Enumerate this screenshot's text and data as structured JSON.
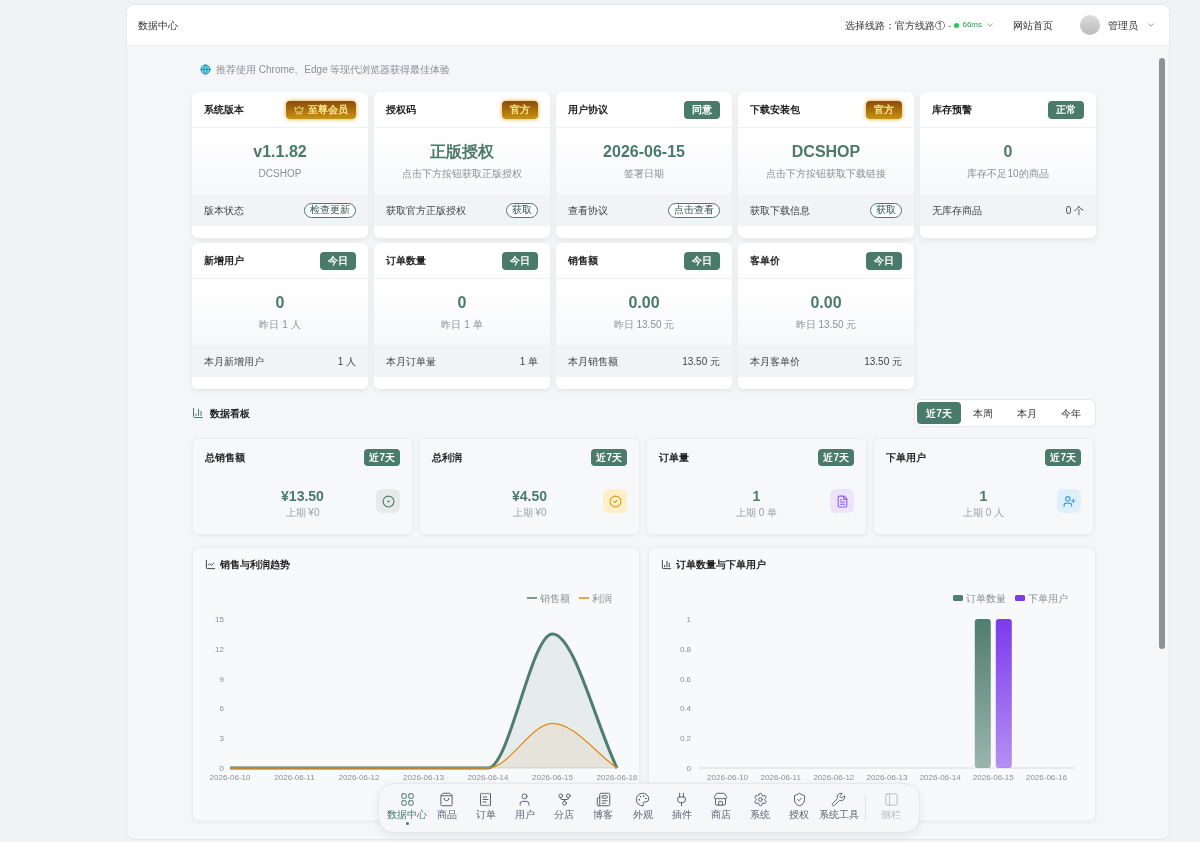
{
  "topbar": {
    "title": "数据中心",
    "route_label": "选择线路：官方线路①",
    "separator": "-",
    "latency": "66ms",
    "home_link": "网站首页",
    "user": "管理员"
  },
  "notice": "推荐使用 Chrome、Edge 等现代浏览器获得最佳体验",
  "info_cards": [
    {
      "title": "系统版本",
      "badge": {
        "text": "至尊会员",
        "kind": "vip"
      },
      "value": "v1.1.82",
      "caption": "DCSHOP",
      "footer_label": "版本状态",
      "footer_action": {
        "kind": "button",
        "text": "检查更新"
      }
    },
    {
      "title": "授权码",
      "badge": {
        "text": "官方",
        "kind": "gold"
      },
      "value": "正版授权",
      "caption": "点击下方按钮获取正版授权",
      "footer_label": "获取官方正版授权",
      "footer_action": {
        "kind": "button",
        "text": "获取"
      }
    },
    {
      "title": "用户协议",
      "badge": {
        "text": "同意",
        "kind": "green"
      },
      "value": "2026-06-15",
      "caption": "签署日期",
      "footer_label": "查看协议",
      "footer_action": {
        "kind": "button",
        "text": "点击查看"
      }
    },
    {
      "title": "下载安装包",
      "badge": {
        "text": "官方",
        "kind": "gold"
      },
      "value": "DCSHOP",
      "caption": "点击下方按钮获取下载链接",
      "footer_label": "获取下载信息",
      "footer_action": {
        "kind": "button",
        "text": "获取"
      }
    },
    {
      "title": "库存预警",
      "badge": {
        "text": "正常",
        "kind": "green"
      },
      "value": "0",
      "caption": "库存不足10的商品",
      "footer_label": "无库存商品",
      "footer_action": {
        "kind": "text",
        "text": "0 个"
      }
    },
    {
      "title": "新增用户",
      "badge": {
        "text": "今日",
        "kind": "green"
      },
      "value": "0",
      "caption": "昨日 1 人",
      "footer_label": "本月新增用户",
      "footer_action": {
        "kind": "text",
        "text": "1 人"
      }
    },
    {
      "title": "订单数量",
      "badge": {
        "text": "今日",
        "kind": "green"
      },
      "value": "0",
      "caption": "昨日 1 单",
      "footer_label": "本月订单量",
      "footer_action": {
        "kind": "text",
        "text": "1 单"
      }
    },
    {
      "title": "销售额",
      "badge": {
        "text": "今日",
        "kind": "green"
      },
      "value": "0.00",
      "caption": "昨日 13.50 元",
      "footer_label": "本月销售额",
      "footer_action": {
        "kind": "text",
        "text": "13.50 元"
      }
    },
    {
      "title": "客单价",
      "badge": {
        "text": "今日",
        "kind": "green"
      },
      "value": "0.00",
      "caption": "昨日 13.50 元",
      "footer_label": "本月客单价",
      "footer_action": {
        "kind": "text",
        "text": "13.50 元"
      }
    }
  ],
  "dashboard": {
    "title": "数据看板",
    "ranges": [
      {
        "label": "近7天",
        "selected": true
      },
      {
        "label": "本周",
        "selected": false
      },
      {
        "label": "本月",
        "selected": false
      },
      {
        "label": "今年",
        "selected": false
      }
    ],
    "stats": [
      {
        "title": "总销售额",
        "badge": "近7天",
        "value": "¥13.50",
        "caption": "上期 ¥0",
        "kind": "sales"
      },
      {
        "title": "总利润",
        "badge": "近7天",
        "value": "¥4.50",
        "caption": "上期 ¥0",
        "kind": "profit"
      },
      {
        "title": "订单量",
        "badge": "近7天",
        "value": "1",
        "caption": "上期 0 单",
        "kind": "orders"
      },
      {
        "title": "下单用户",
        "badge": "近7天",
        "value": "1",
        "caption": "上期 0 人",
        "kind": "users"
      }
    ],
    "charts": [
      {
        "title": "销售与利润趋势",
        "chart_data": {
          "type": "area",
          "legend": "upper right",
          "categories": [
            "2026-06-10",
            "2026-06-11",
            "2026-06-12",
            "2026-06-13",
            "2026-06-14",
            "2026-06-15",
            "2026-06-16"
          ],
          "series": [
            {
              "name": "销售额",
              "color": "#4f7d6e",
              "values": [
                0,
                0,
                0,
                0,
                0,
                13.5,
                0
              ]
            },
            {
              "name": "利润",
              "color": "#e08a1e",
              "values": [
                0,
                0,
                0,
                0,
                0,
                4.5,
                0
              ]
            }
          ],
          "ylim": [
            0,
            15
          ],
          "yticks": [
            0,
            3,
            6,
            9,
            12,
            15
          ]
        }
      },
      {
        "title": "订单数量与下单用户",
        "chart_data": {
          "type": "bar",
          "legend": "upper right",
          "categories": [
            "2026-06-10",
            "2026-06-11",
            "2026-06-12",
            "2026-06-13",
            "2026-06-14",
            "2026-06-15",
            "2026-06-16"
          ],
          "series": [
            {
              "name": "订单数量",
              "color": "#4f7d6e",
              "values": [
                0,
                0,
                0,
                0,
                0,
                1,
                0
              ]
            },
            {
              "name": "下单用户",
              "color": "#7c3aed",
              "values": [
                0,
                0,
                0,
                0,
                0,
                1,
                0
              ]
            }
          ],
          "ylim": [
            0,
            1
          ],
          "yticks": [
            0,
            0.2,
            0.4,
            0.6,
            0.8,
            1
          ]
        }
      }
    ]
  },
  "dock": {
    "items": [
      {
        "label": "数据中心",
        "selected": true
      },
      {
        "label": "商品",
        "selected": false
      },
      {
        "label": "订单",
        "selected": false
      },
      {
        "label": "用户",
        "selected": false
      },
      {
        "label": "分店",
        "selected": false
      },
      {
        "label": "博客",
        "selected": false
      },
      {
        "label": "外观",
        "selected": false
      },
      {
        "label": "插件",
        "selected": false
      },
      {
        "label": "商店",
        "selected": false
      },
      {
        "label": "系统",
        "selected": false
      },
      {
        "label": "授权",
        "selected": false
      },
      {
        "label": "系统工具",
        "selected": false
      }
    ],
    "sidebar_toggle": {
      "label": "侧栏",
      "disabled": true
    }
  }
}
